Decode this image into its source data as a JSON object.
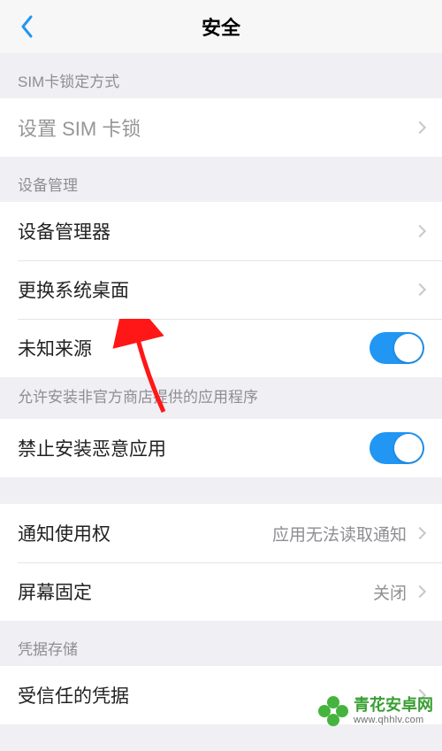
{
  "header": {
    "title": "安全"
  },
  "sections": {
    "sim": {
      "header": "SIM卡锁定方式",
      "set_sim_lock": "设置 SIM 卡锁"
    },
    "device": {
      "header": "设备管理",
      "device_admin": "设备管理器",
      "change_launcher": "更换系统桌面",
      "unknown_sources": "未知来源",
      "unknown_sources_footer": "允许安装非官方商店提供的应用程序",
      "block_malware": "禁止安装恶意应用"
    },
    "access": {
      "notification_access": "通知使用权",
      "notification_access_detail": "应用无法读取通知",
      "screen_pinning": "屏幕固定",
      "screen_pinning_detail": "关闭"
    },
    "credentials": {
      "header": "凭据存储",
      "trusted": "受信任的凭据"
    }
  },
  "toggles": {
    "unknown_sources": true,
    "block_malware": true
  },
  "watermark": {
    "title": "青花安卓网",
    "url": "www.qhhlv.com"
  }
}
